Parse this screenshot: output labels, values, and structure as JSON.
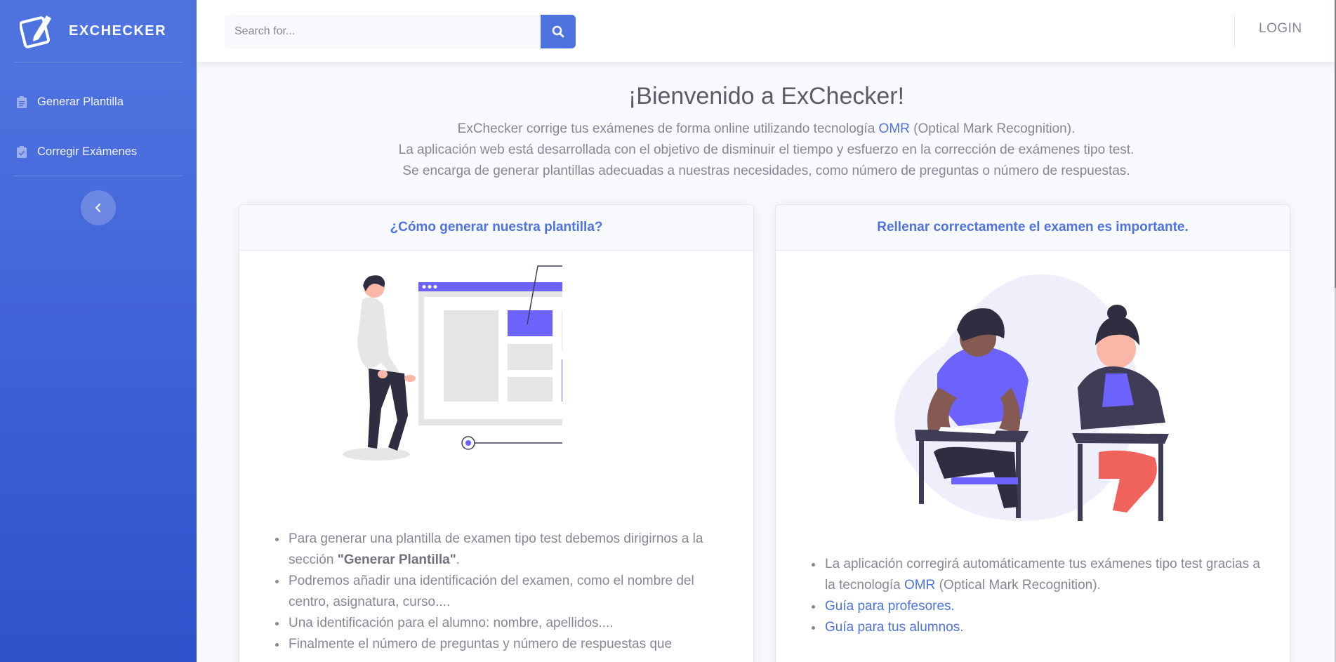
{
  "brand": {
    "name": "EXCHECKER"
  },
  "sidebar": {
    "items": [
      {
        "label": "Generar Plantilla",
        "icon": "clipboard-icon"
      },
      {
        "label": "Corregir Exámenes",
        "icon": "clipboard-check-icon"
      }
    ],
    "toggle_icon": "chevron-left-icon"
  },
  "topbar": {
    "search_placeholder": "Search for...",
    "search_icon": "search-icon",
    "login_label": "LOGIN"
  },
  "main": {
    "title": "¡Bienvenido a ExChecker!",
    "intro": {
      "line1_pre": "ExChecker corrige tus exámenes de forma online utilizando tecnología ",
      "line1_link": "OMR",
      "line1_post": " (Optical Mark Recognition).",
      "line2": "La aplicación web está desarrollada con el objetivo de disminuir el tiempo y esfuerzo en la corrección de exámenes tipo test.",
      "line3": "Se encarga de generar plantillas adecuadas a nuestras necesidades, como número de preguntas o número de respuestas."
    }
  },
  "cards": {
    "left": {
      "title": "¿Cómo generar nuestra plantilla?",
      "bullets": {
        "b1_pre": "Para generar una plantilla de examen tipo test debemos dirigirnos a la sección ",
        "b1_bold": "\"Generar Plantilla\"",
        "b1_post": ".",
        "b2": "Podremos añadir una identificación del examen, como el nombre del centro, asignatura, curso....",
        "b3": "Una identificación para el alumno: nombre, apellidos....",
        "b4": "Finalmente el número de preguntas y número de respuestas que"
      }
    },
    "right": {
      "title": "Rellenar correctamente el examen es importante.",
      "bullets": {
        "b1_pre": "La aplicación corregirá automáticamente tus exámenes tipo test gracias a la tecnología ",
        "b1_link": "OMR",
        "b1_post": " (Optical Mark Recognition).",
        "b2_link": "Guía para profesores.",
        "b3_link": "Guía para tus alumnos."
      }
    }
  },
  "colors": {
    "primary": "#4e73df",
    "illustration_accent": "#6c63ff",
    "skin": "#f9b7a8",
    "pants": "#f0625c"
  }
}
